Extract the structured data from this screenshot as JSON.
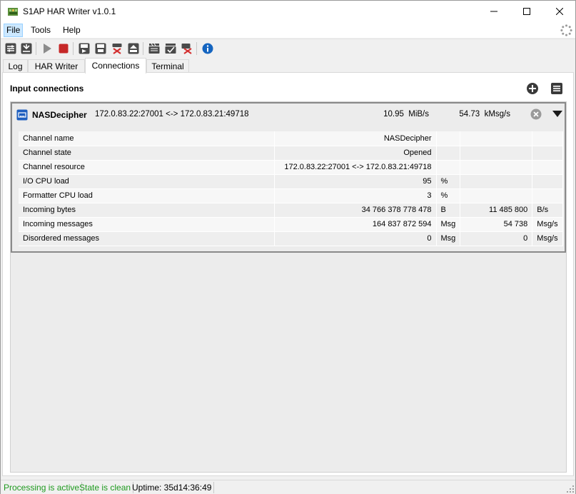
{
  "window": {
    "title": "S1AP HAR Writer v1.0.1",
    "controls": [
      "minimize-icon",
      "maximize-icon",
      "close-icon"
    ]
  },
  "menu": {
    "file": "File",
    "tools": "Tools",
    "help": "Help"
  },
  "toolbar": {
    "icons": [
      "settings-icon",
      "import-icon",
      "play-icon",
      "stop-icon",
      "save-icon",
      "save-as-icon",
      "delete-icon",
      "eject-icon",
      "clapper-icon",
      "clapper-check-icon",
      "clear-icon",
      "info-icon"
    ]
  },
  "tabs": [
    {
      "label": "Log"
    },
    {
      "label": "HAR Writer"
    },
    {
      "label": "Connections"
    },
    {
      "label": "Terminal"
    }
  ],
  "connections": {
    "title": "Input connections",
    "items": [
      {
        "name": "NASDecipher",
        "resource": "172.0.83.22:27001 <-> 172.0.83.21:49718",
        "rate_value": "10.95",
        "rate_unit": "MiB/s",
        "msg_rate_value": "54.73",
        "msg_rate_unit": "kMsg/s",
        "properties": [
          {
            "name": "Channel name",
            "value": "NASDecipher",
            "unit": "",
            "rate": "",
            "rate_unit": ""
          },
          {
            "name": "Channel state",
            "value": "Opened",
            "unit": "",
            "rate": "",
            "rate_unit": ""
          },
          {
            "name": "Channel resource",
            "value": "172.0.83.22:27001 <-> 172.0.83.21:49718",
            "unit": "",
            "rate": "",
            "rate_unit": ""
          },
          {
            "name": "I/O CPU load",
            "value": "95",
            "unit": "%",
            "rate": "",
            "rate_unit": ""
          },
          {
            "name": "Formatter CPU load",
            "value": "3",
            "unit": "%",
            "rate": "",
            "rate_unit": ""
          },
          {
            "name": "Incoming bytes",
            "value": "34 766 378 778 478",
            "unit": "B",
            "rate": "11 485 800",
            "rate_unit": "B/s"
          },
          {
            "name": "Incoming messages",
            "value": "164 837 872 594",
            "unit": "Msg",
            "rate": "54 738",
            "rate_unit": "Msg/s"
          },
          {
            "name": "Disordered messages",
            "value": "0",
            "unit": "Msg",
            "rate": "0",
            "rate_unit": "Msg/s"
          }
        ]
      }
    ]
  },
  "status": {
    "processing": "Processing is active",
    "state": "State is clean",
    "uptime": "Uptime: 35d14:36:49"
  },
  "colors": {
    "status_green": "#1e9a1e",
    "info_blue": "#1565c0",
    "stop_red": "#c62828",
    "delete_red": "#d32f2f"
  }
}
